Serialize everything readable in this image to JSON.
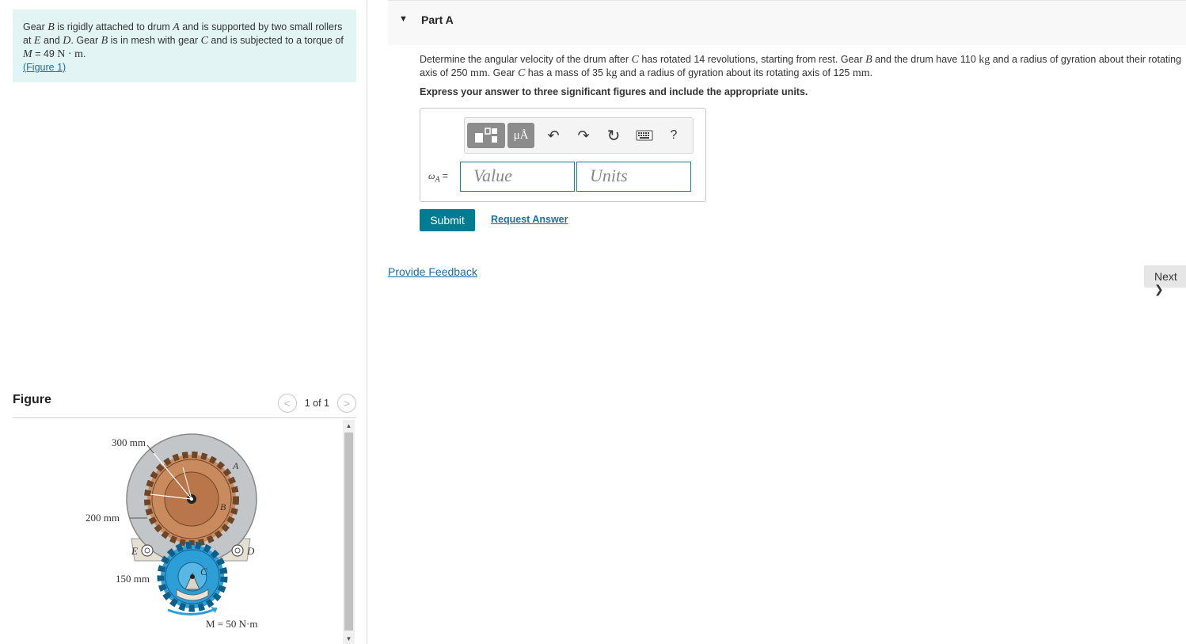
{
  "problem": {
    "t1": "Gear ",
    "v1": "B",
    "t2": " is rigidly attached to drum ",
    "v2": "A",
    "t3": " and is supported by two small rollers at ",
    "v3": "E",
    "t4": " and ",
    "v4": "D",
    "t5": ". Gear ",
    "v5": "B",
    "t6": " is in mesh with gear ",
    "v6": "C",
    "t7": " and is subjected to a torque of ",
    "v7": "M",
    "t8": " = 49 ",
    "u8": "N · m",
    "t9": ".",
    "figure_link": "(Figure 1)"
  },
  "figure": {
    "title": "Figure",
    "pager": "1 of 1",
    "prev_glyph": "<",
    "next_glyph": ">",
    "labels": {
      "r300": "300 mm",
      "r200": "200 mm",
      "r150": "150 mm",
      "A": "A",
      "B": "B",
      "C": "C",
      "D": "D",
      "E": "E",
      "moment": "M = 50 N·m"
    },
    "colors": {
      "drum": "#c3c6c9",
      "gear_b": "#c98a5e",
      "gear_c": "#2e9fd6",
      "frame": "#e6e0d3"
    }
  },
  "part": {
    "caret": "▼",
    "title": "Part A",
    "q1": "Determine the angular velocity of the drum after ",
    "qv1": "C",
    "q2": " has rotated 14 revolutions, starting from rest. Gear ",
    "qv2": "B",
    "q3": " and the drum have 110 ",
    "qu3": "kg",
    "q4": " and a radius of gyration about their rotating axis of 250 ",
    "qu4": "mm",
    "q5": ". Gear ",
    "qv5": "C",
    "q6": " has a mass of 35 ",
    "qu6": "kg",
    "q7": " and a radius of gyration about its rotating axis of 125 ",
    "qu7": "mm",
    "q8": ".",
    "instruction": "Express your answer to three significant figures and include the appropriate units."
  },
  "toolbar": {
    "units_label": "μÅ",
    "undo_icon": "↶",
    "redo_icon": "↷",
    "reset_icon": "↻",
    "help_label": "?"
  },
  "answer": {
    "label_var": "ω",
    "label_sub": "A",
    "label_eq": " =",
    "value_placeholder": "Value",
    "units_placeholder": "Units"
  },
  "actions": {
    "submit": "Submit",
    "request_answer": "Request Answer",
    "feedback": "Provide Feedback",
    "next": "Next",
    "next_glyph": "❯"
  }
}
